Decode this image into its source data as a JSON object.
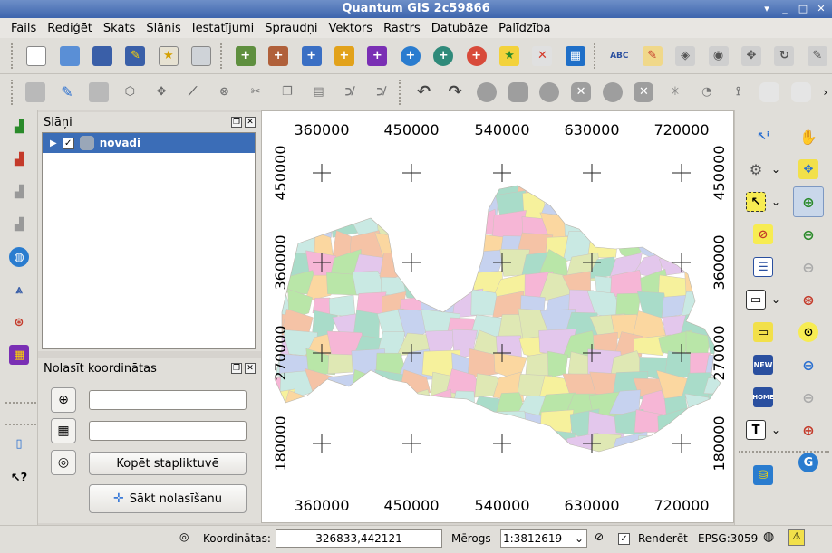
{
  "window": {
    "title": "Quantum GIS 2c59866"
  },
  "menu": [
    "Fails",
    "Rediģēt",
    "Skats",
    "Slānis",
    "Iestatījumi",
    "Spraudņi",
    "Vektors",
    "Rastrs",
    "Datubāze",
    "Palīdzība"
  ],
  "layers_panel": {
    "title": "Slāņi",
    "layers": [
      {
        "name": "novadi",
        "checked": true
      }
    ]
  },
  "coords_panel": {
    "title": "Nolasīt koordinātas",
    "field1_value": "",
    "field2_value": "",
    "copy_label": "Kopēt stapliktuvē",
    "start_label": "Sākt nolasīšanu"
  },
  "map": {
    "x_ticks": [
      "360000",
      "450000",
      "540000",
      "630000",
      "720000"
    ],
    "y_ticks": [
      "450000",
      "360000",
      "270000",
      "180000"
    ]
  },
  "status": {
    "coord_label": "Koordinātas:",
    "coord_value": "326833,442121",
    "scale_label": "Mērogs",
    "scale_value": "1:3812619",
    "render_label": "Renderēt",
    "render_checked": true,
    "crs": "EPSG:3059"
  },
  "colors": {
    "accent": "#3b6db7",
    "title_bar": "#3d65ad",
    "map_palette": [
      "#f6b6d6",
      "#b9e6a8",
      "#fbd7a0",
      "#c6d2ef",
      "#f6f19c",
      "#a9dcc9",
      "#f5c3a6",
      "#dfe8b4",
      "#e3c7ec",
      "#c9e9e3"
    ]
  }
}
